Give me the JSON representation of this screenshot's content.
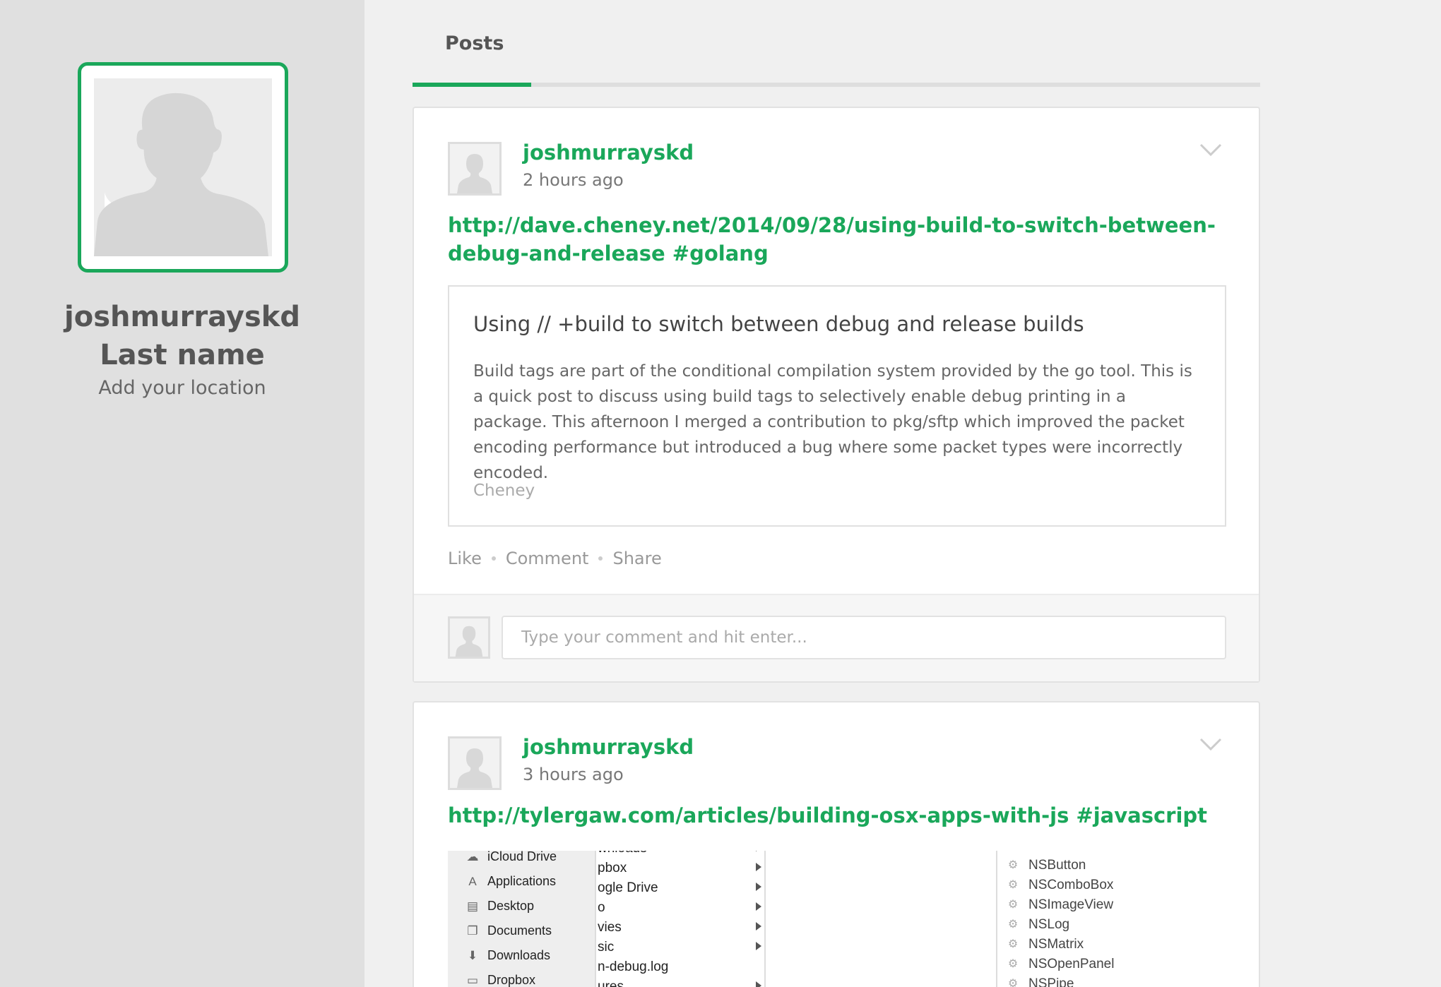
{
  "profile": {
    "name": "joshmurrayskd Last name",
    "location": "Add your location"
  },
  "tabs": {
    "posts_label": "Posts"
  },
  "colors": {
    "accent": "#1aa75a",
    "sidebar_bg": "#e0e0e0",
    "page_bg": "#f0f0f0"
  },
  "posts": [
    {
      "author": "joshmurrayskd",
      "time": "2 hours ago",
      "link_text": "http://dave.cheney.net/2014/09/28/using-build-to-switch-between-debug-and-release #golang",
      "preview": {
        "title": "Using // +build to switch between debug and release builds",
        "description": "Build tags are part of the conditional compilation system provided by the go tool. This is a quick post to discuss using build tags to selectively enable debug printing in a package. This afternoon I merged a contribution to pkg/sftp which improved the packet encoding performance but introduced a bug where some packet types were incorrectly encoded.",
        "source": "Cheney"
      },
      "actions": {
        "like": "Like",
        "comment": "Comment",
        "share": "Share"
      },
      "comment_placeholder": "Type your comment and hit enter..."
    },
    {
      "author": "joshmurrayskd",
      "time": "3 hours ago",
      "link_text": "http://tylergaw.com/articles/building-osx-apps-with-js #javascript",
      "image": {
        "sidebar_items": [
          {
            "icon": "cloud-icon",
            "label": "iCloud Drive"
          },
          {
            "icon": "applications-icon",
            "label": "Applications"
          },
          {
            "icon": "desktop-icon",
            "label": "Desktop"
          },
          {
            "icon": "documents-icon",
            "label": "Documents"
          },
          {
            "icon": "downloads-icon",
            "label": "Downloads"
          },
          {
            "icon": "folder-icon",
            "label": "Dropbox"
          }
        ],
        "column_items": [
          "wnloads",
          "pbox",
          "ogle Drive",
          "o",
          "vies",
          "sic",
          "n-debug.log",
          "ures"
        ],
        "class_items": [
          "NSButton",
          "NSComboBox",
          "NSImageView",
          "NSLog",
          "NSMatrix",
          "NSOpenPanel",
          "NSPipe"
        ]
      }
    }
  ]
}
